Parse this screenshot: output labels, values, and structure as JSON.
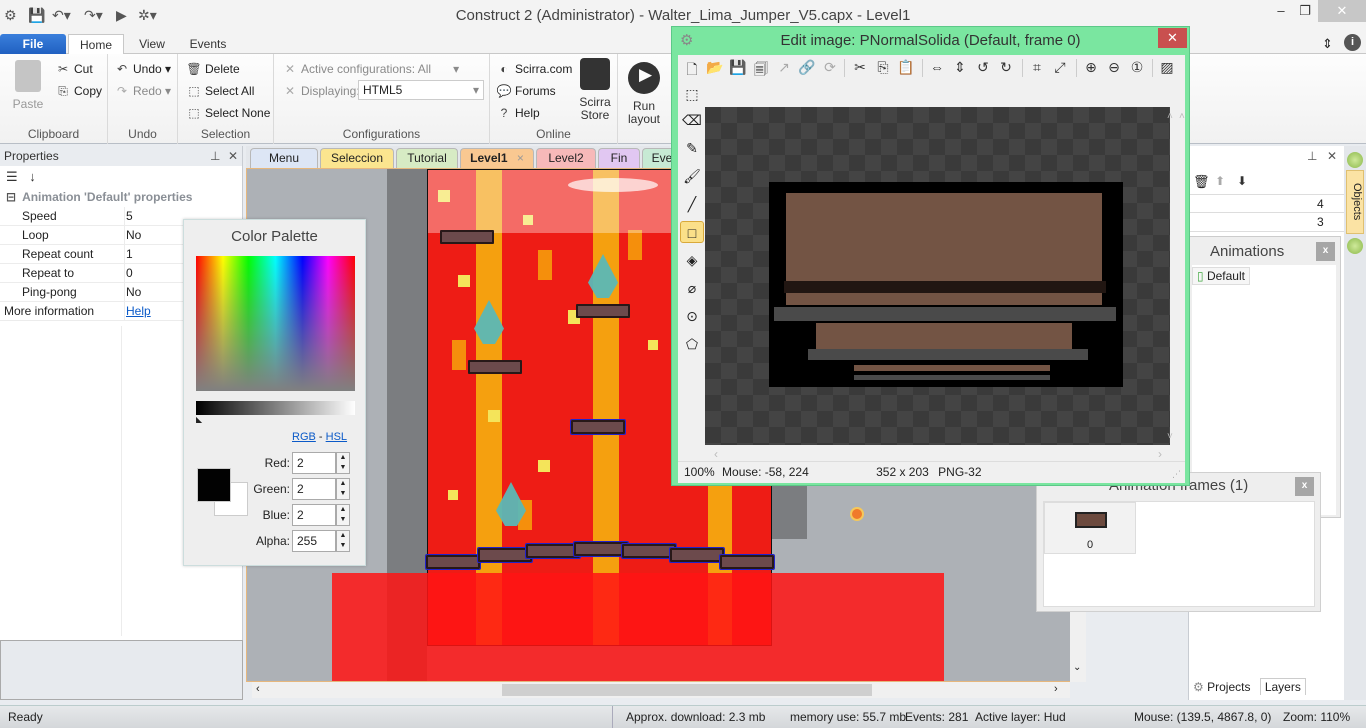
{
  "app": {
    "title": "Construct 2 (Administrator) - Walter_Lima_Jumper_V5.capx - Level1"
  },
  "window_controls": {
    "minimize": "–",
    "restore": "❐",
    "close": "✕"
  },
  "ribbon": {
    "tabs": [
      "File",
      "Home",
      "View",
      "Events"
    ],
    "active_tab": "Home",
    "clipboard": {
      "label": "Clipboard",
      "paste": "Paste",
      "cut": "Cut",
      "copy": "Copy"
    },
    "undo": {
      "label": "Undo",
      "undo": "Undo",
      "redo": "Redo"
    },
    "selection": {
      "label": "Selection",
      "delete": "Delete",
      "select_all": "Select All",
      "select_none": "Select None"
    },
    "configurations": {
      "label": "Configurations",
      "active": "Active configurations: All",
      "displaying_label": "Displaying:",
      "displaying_value": "HTML5"
    },
    "online": {
      "label": "Online",
      "scirra": "Scirra.com",
      "forums": "Forums",
      "help": "Help",
      "store": "Scirra Store"
    },
    "preview": {
      "run": "Run layout"
    }
  },
  "properties": {
    "title": "Properties",
    "category": "Animation 'Default' properties",
    "rows": [
      {
        "key": "Speed",
        "value": "5"
      },
      {
        "key": "Loop",
        "value": "No"
      },
      {
        "key": "Repeat count",
        "value": "1"
      },
      {
        "key": "Repeat to",
        "value": "0"
      },
      {
        "key": "Ping-pong",
        "value": "No"
      }
    ],
    "more_info_label": "More information",
    "more_info_link": "Help"
  },
  "doc_tabs": [
    {
      "label": "Menu",
      "color": "#dde6f5"
    },
    {
      "label": "Seleccion",
      "color": "#fbe58f"
    },
    {
      "label": "Tutorial",
      "color": "#d7ebc4"
    },
    {
      "label": "Level1",
      "color": "#f9c891",
      "active": true
    },
    {
      "label": "Level2",
      "color": "#f7b9b9"
    },
    {
      "label": "Fin",
      "color": "#e1c7f2"
    },
    {
      "label": "Eve",
      "color": "#c7ead4"
    }
  ],
  "color_palette": {
    "title": "Color Palette",
    "mode_rgb": "RGB",
    "mode_sep": "-",
    "mode_hsl": "HSL",
    "fields": [
      {
        "label": "Red:",
        "value": "2"
      },
      {
        "label": "Green:",
        "value": "2"
      },
      {
        "label": "Blue:",
        "value": "2"
      },
      {
        "label": "Alpha:",
        "value": "255"
      }
    ],
    "primary_color": "#020202",
    "secondary_color": "#ffffff"
  },
  "edit_image": {
    "title": "Edit image: PNormalSolida (Default, frame 0)",
    "close": "✕",
    "zoom": "100%",
    "mouse": "Mouse: -58, 224",
    "size": "352 x 203",
    "format": "PNG-32",
    "active_tool": "rectangle"
  },
  "right_panel": {
    "values": [
      "4",
      "3"
    ],
    "animations_title": "Animations",
    "animations": [
      "Default"
    ],
    "objects_tab": "Objects"
  },
  "animation_frames": {
    "title": "Animation frames (1)",
    "frames": [
      "0"
    ]
  },
  "bottom_tabs": {
    "projects": "Projects",
    "layers": "Layers"
  },
  "status": {
    "ready": "Ready",
    "download": "Approx. download: 2.3 mb",
    "memory": "memory use: 55.7 mb",
    "events": "Events: 281",
    "layer": "Active layer: Hud",
    "mouse": "Mouse: (139.5, 4867.8, 0)",
    "zoom": "Zoom: 110%"
  }
}
